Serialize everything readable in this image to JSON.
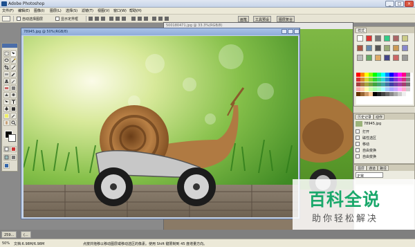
{
  "app": {
    "title": "Adobe Photoshop",
    "min": "_",
    "max": "□",
    "close": "×"
  },
  "menu": [
    "文件(F)",
    "编辑(E)",
    "图像(I)",
    "图层(L)",
    "选择(S)",
    "滤镜(T)",
    "视图(V)",
    "窗口(W)",
    "帮助(H)"
  ],
  "options": {
    "auto_select": "自动选择图层",
    "show_transform": "显示定界框"
  },
  "well": {
    "brushes": "画笔",
    "tool_presets": "工具预设",
    "layer_comps": "图层复合"
  },
  "background_doc": {
    "caption": "500180471.jpg @ 33.3%(RGB/8)"
  },
  "document": {
    "caption": "78945.jpg @ 50%(RGB/8)"
  },
  "panels": {
    "styles": {
      "tab": "样式"
    },
    "history": {
      "tabs": [
        "历史记录",
        "动作"
      ],
      "snapshot": "78945.jpg",
      "items": [
        "打开",
        "磁性选区",
        "移动",
        "自由变换",
        "自由变换"
      ]
    },
    "layers": {
      "tabs": [
        "图层",
        "通道",
        "路径"
      ],
      "blend": "正常"
    }
  },
  "taskbar": {
    "tab1": "259...",
    "tab2": "(..."
  },
  "status": {
    "zoom": "50%",
    "doc": "文档:6.98M/6.98M",
    "hint": "点按并拖移以移动图层或移动选区的像素。使用 Shift 键限制到 45 度增量方向。"
  },
  "watermark": {
    "title": "百科全说",
    "subtitle": "助你轻松解决"
  },
  "colors": {
    "accent": "#1aa86b",
    "doc_frame": "#5b6f96"
  }
}
